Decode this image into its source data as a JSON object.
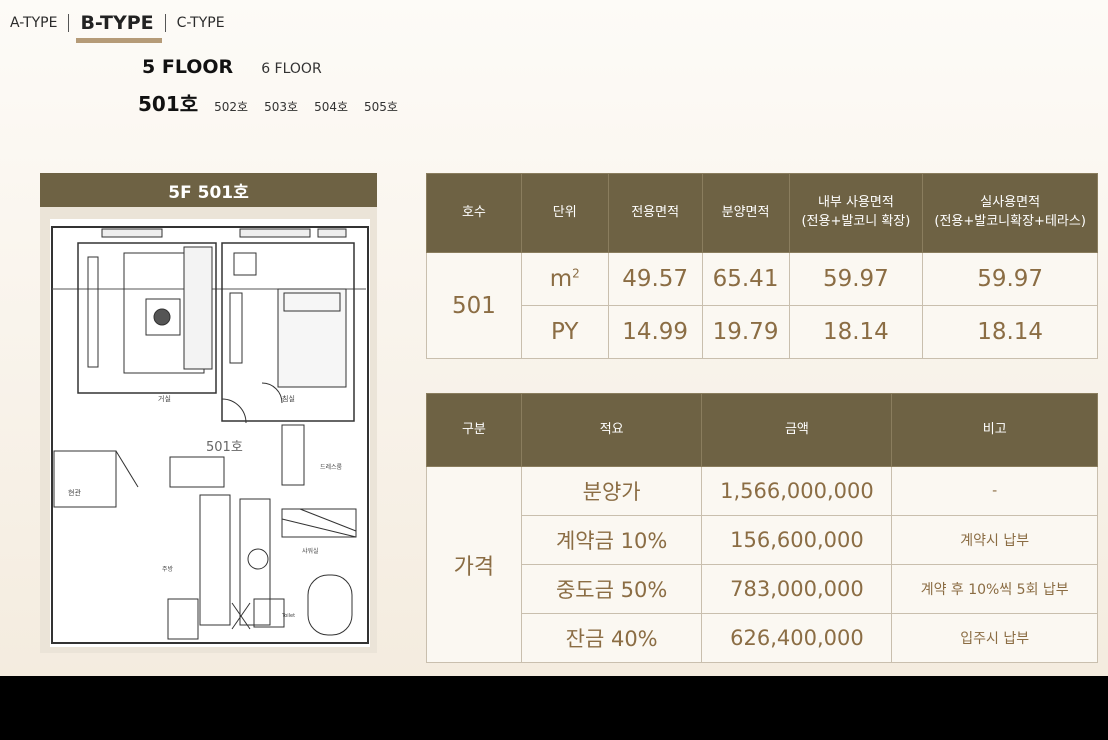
{
  "type_tabs": [
    "A-TYPE",
    "B-TYPE",
    "C-TYPE"
  ],
  "floor_tabs": [
    "5 FLOOR",
    "6 FLOOR"
  ],
  "unit_tabs": [
    "501호",
    "502호",
    "503호",
    "504호",
    "505호"
  ],
  "plan": {
    "title": "5F 501호",
    "room_labels": {
      "living": "거실",
      "bedroom": "침실",
      "unit": "501호",
      "dress": "드레스룸",
      "entrance": "현관",
      "kitchen": "주방",
      "shower": "샤워실",
      "toilet": "Toilet"
    }
  },
  "area_table": {
    "headers": [
      "호수",
      "단위",
      "전용면적",
      "분양면적",
      "내부 사용면적",
      "실사용면적"
    ],
    "header_notes": [
      "",
      "",
      "",
      "",
      "(전용+발코니 확장)",
      "(전용+발코니확장+테라스)"
    ],
    "unit": "501",
    "rows": [
      {
        "unit_label": "m",
        "unit_sup": "2",
        "values": [
          "49.57",
          "65.41",
          "59.97",
          "59.97"
        ]
      },
      {
        "unit_label": "PY",
        "unit_sup": "",
        "values": [
          "14.99",
          "19.79",
          "18.14",
          "18.14"
        ]
      }
    ]
  },
  "price_table": {
    "headers": [
      "구분",
      "적요",
      "금액",
      "비고"
    ],
    "category": "가격",
    "rows": [
      {
        "item": "분양가",
        "amount": "1,566,000,000",
        "note": "-"
      },
      {
        "item": "계약금 10%",
        "amount": "156,600,000",
        "note": "계약시 납부"
      },
      {
        "item": "중도금 50%",
        "amount": "783,000,000",
        "note": "계약 후 10%씩 5회 납부"
      },
      {
        "item": "잔금 40%",
        "amount": "626,400,000",
        "note": "입주시 납부"
      }
    ]
  }
}
